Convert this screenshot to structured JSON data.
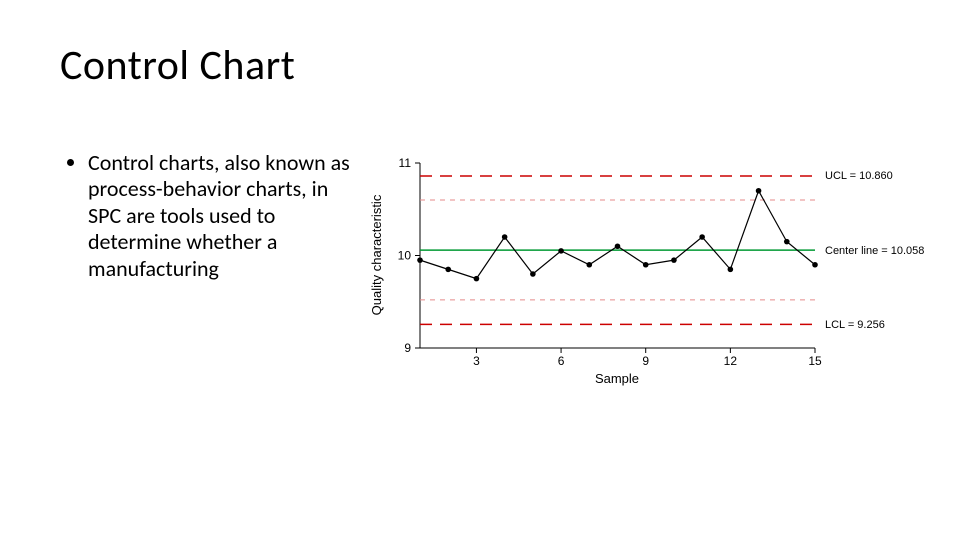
{
  "title": "Control Chart",
  "bullet": "Control charts, also known as process-behavior charts, in SPC are tools used to determine whether a manufacturing",
  "chart_data": {
    "type": "line",
    "x": [
      1,
      2,
      3,
      4,
      5,
      6,
      7,
      8,
      9,
      10,
      11,
      12,
      13,
      14,
      15
    ],
    "values": [
      9.95,
      9.85,
      9.75,
      10.2,
      9.8,
      10.05,
      9.9,
      10.1,
      9.9,
      9.95,
      10.2,
      9.85,
      10.7,
      10.15,
      9.9
    ],
    "xlabel": "Sample",
    "ylabel": "Quality characteristic",
    "xlim": [
      1,
      15
    ],
    "ylim": [
      9.0,
      11.0
    ],
    "y_ticks": [
      9.0,
      10.0,
      11.0
    ],
    "x_ticks": [
      3,
      6,
      9,
      12,
      15
    ],
    "reference_lines": {
      "ucl": 10.86,
      "upper_2s": 10.6,
      "center": 10.058,
      "lower_2s": 9.52,
      "lcl": 9.256
    },
    "annotations": {
      "ucl": "UCL = 10.860",
      "center": "Center line = 10.058",
      "lcl": "LCL = 9.256"
    }
  }
}
